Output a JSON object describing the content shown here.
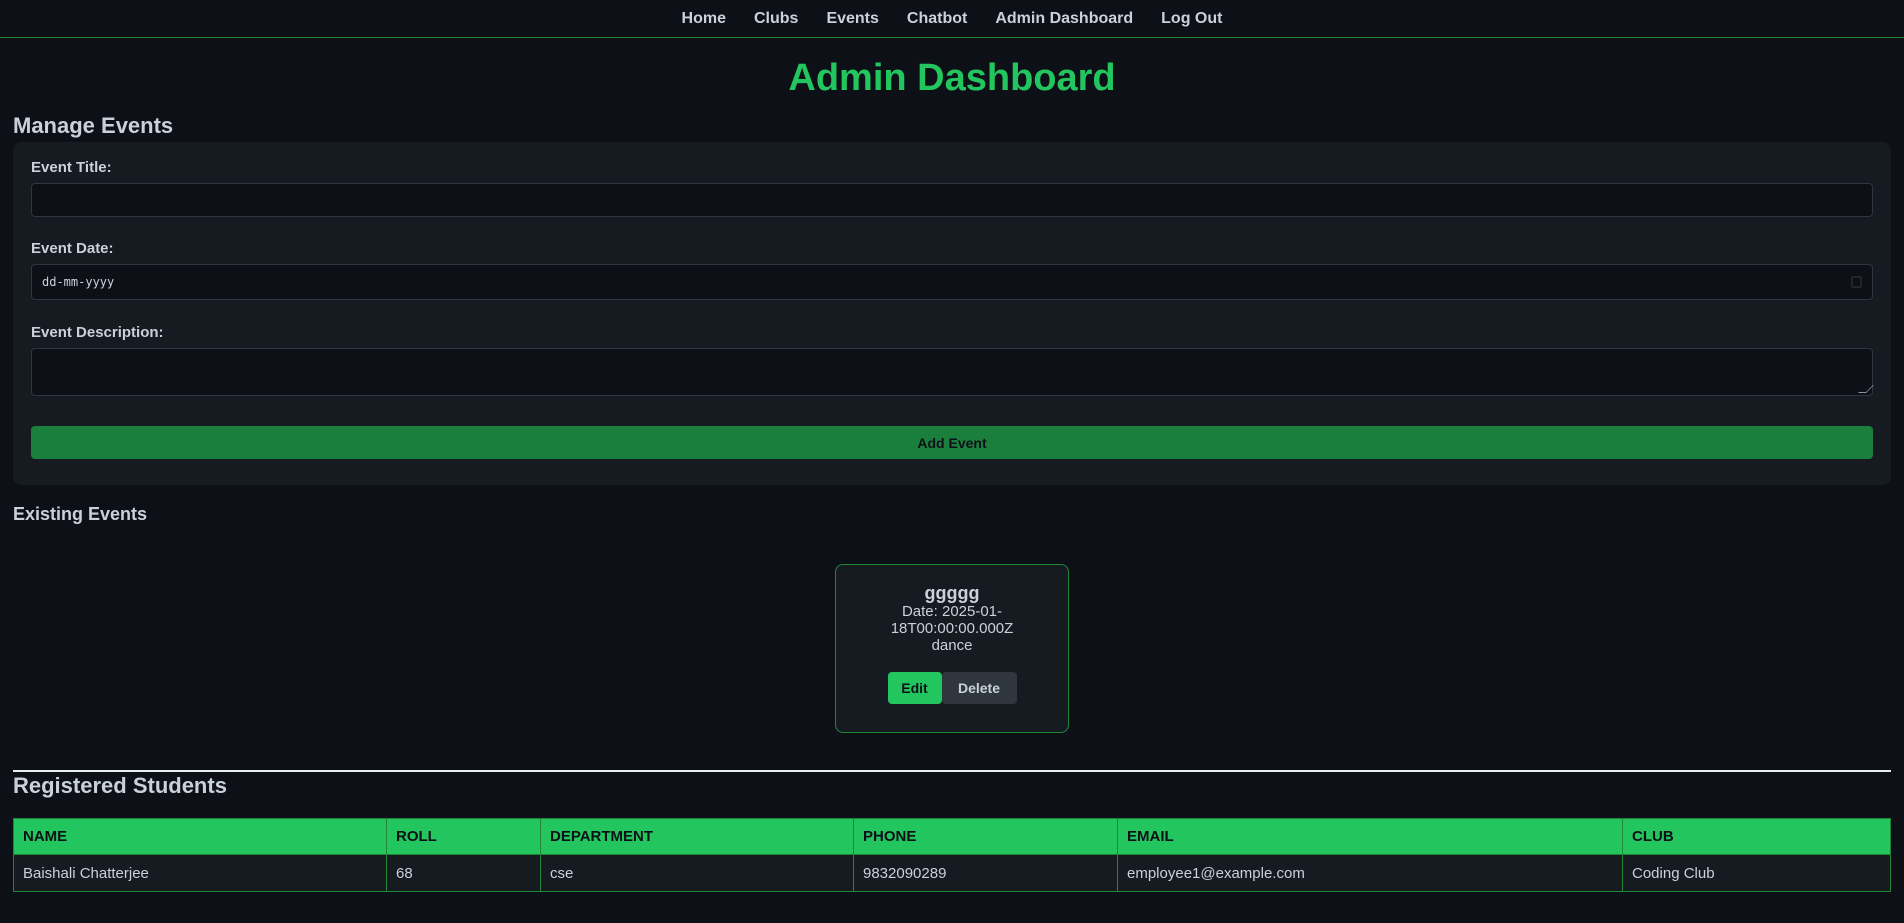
{
  "nav": {
    "items": [
      "Home",
      "Clubs",
      "Events",
      "Chatbot",
      "Admin Dashboard",
      "Log Out"
    ]
  },
  "page": {
    "title": "Admin Dashboard"
  },
  "manage_events": {
    "heading": "Manage Events",
    "title_label": "Event Title:",
    "title_value": "",
    "date_label": "Event Date:",
    "date_placeholder": "dd-mm-yyyy",
    "description_label": "Event Description:",
    "description_value": "",
    "add_button": "Add Event"
  },
  "existing_events": {
    "heading": "Existing Events",
    "events": [
      {
        "title": "ggggg",
        "date": "Date: 2025-01-18T00:00:00.000Z",
        "description": "dance",
        "edit_label": "Edit",
        "delete_label": "Delete"
      }
    ]
  },
  "students": {
    "heading": "Registered Students",
    "columns": [
      "NAME",
      "ROLL",
      "DEPARTMENT",
      "PHONE",
      "EMAIL",
      "CLUB"
    ],
    "rows": [
      [
        "Baishali Chatterjee",
        "68",
        "cse",
        "9832090289",
        "employee1@example.com",
        "Coding Club"
      ]
    ]
  },
  "colors": {
    "accent": "#22c55e",
    "background": "#0d1117",
    "panel": "#161b22",
    "button": "#1a7f3c"
  }
}
